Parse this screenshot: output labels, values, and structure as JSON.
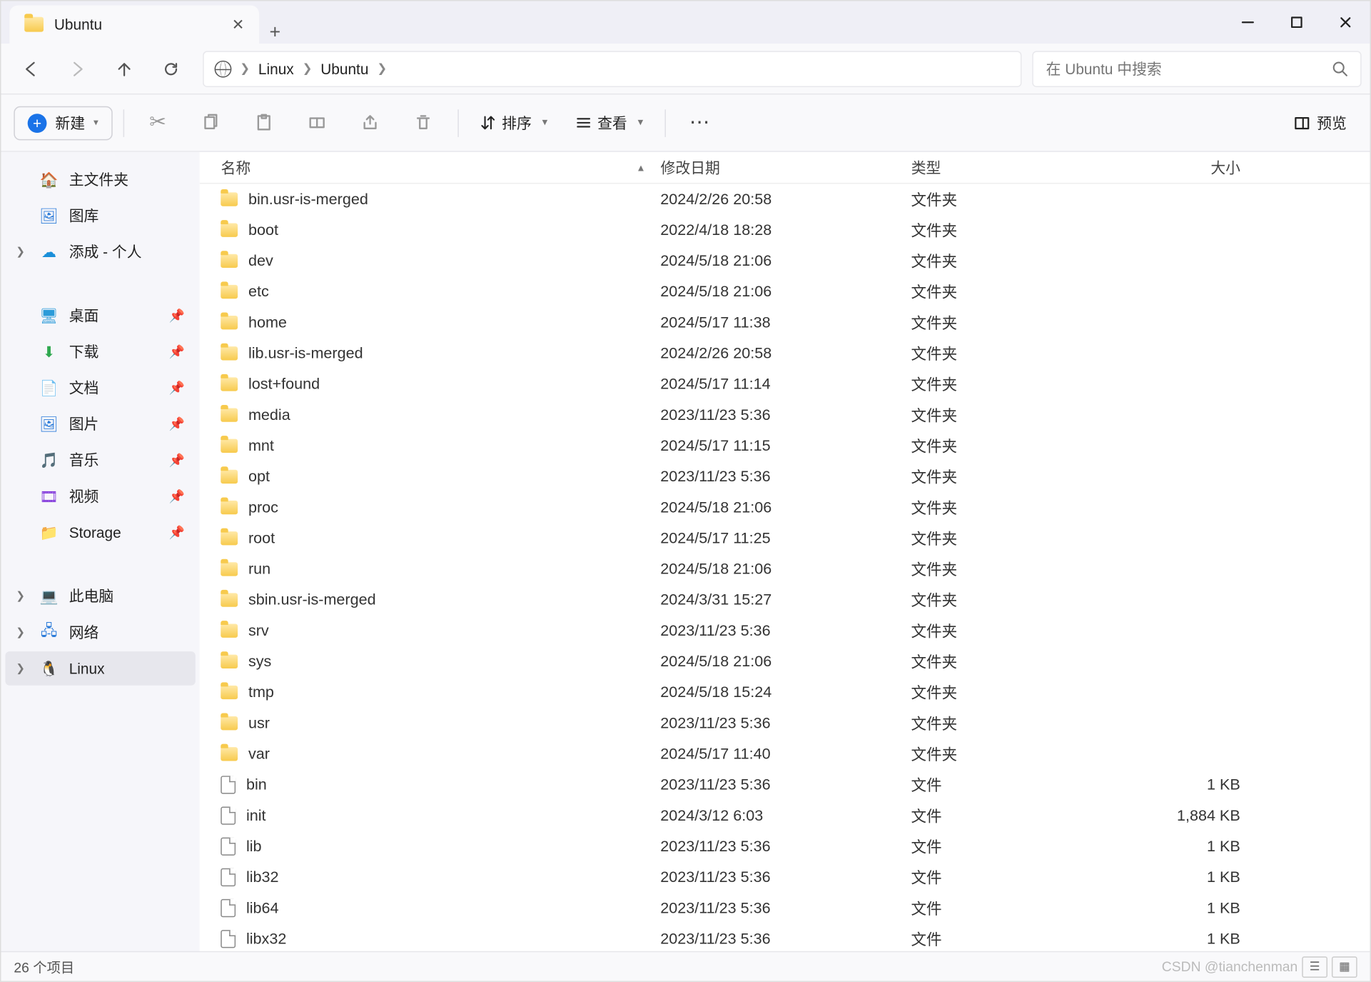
{
  "tab": {
    "title": "Ubuntu"
  },
  "breadcrumb": {
    "items": [
      "Linux",
      "Ubuntu"
    ]
  },
  "search": {
    "placeholder": "在 Ubuntu 中搜索"
  },
  "toolbar": {
    "new_label": "新建",
    "sort_label": "排序",
    "view_label": "查看",
    "preview_label": "预览"
  },
  "sidebar": {
    "home": "主文件夹",
    "gallery": "图库",
    "personal": "添成 - 个人",
    "desktop": "桌面",
    "downloads": "下载",
    "documents": "文档",
    "pictures": "图片",
    "music": "音乐",
    "videos": "视频",
    "storage": "Storage",
    "this_pc": "此电脑",
    "network": "网络",
    "linux": "Linux"
  },
  "columns": {
    "name": "名称",
    "date": "修改日期",
    "type": "类型",
    "size": "大小"
  },
  "type_labels": {
    "folder": "文件夹",
    "file": "文件"
  },
  "rows": [
    {
      "name": "bin.usr-is-merged",
      "date": "2024/2/26 20:58",
      "type": "folder",
      "size": ""
    },
    {
      "name": "boot",
      "date": "2022/4/18 18:28",
      "type": "folder",
      "size": ""
    },
    {
      "name": "dev",
      "date": "2024/5/18 21:06",
      "type": "folder",
      "size": ""
    },
    {
      "name": "etc",
      "date": "2024/5/18 21:06",
      "type": "folder",
      "size": ""
    },
    {
      "name": "home",
      "date": "2024/5/17 11:38",
      "type": "folder",
      "size": ""
    },
    {
      "name": "lib.usr-is-merged",
      "date": "2024/2/26 20:58",
      "type": "folder",
      "size": ""
    },
    {
      "name": "lost+found",
      "date": "2024/5/17 11:14",
      "type": "folder",
      "size": ""
    },
    {
      "name": "media",
      "date": "2023/11/23 5:36",
      "type": "folder",
      "size": ""
    },
    {
      "name": "mnt",
      "date": "2024/5/17 11:15",
      "type": "folder",
      "size": ""
    },
    {
      "name": "opt",
      "date": "2023/11/23 5:36",
      "type": "folder",
      "size": ""
    },
    {
      "name": "proc",
      "date": "2024/5/18 21:06",
      "type": "folder",
      "size": ""
    },
    {
      "name": "root",
      "date": "2024/5/17 11:25",
      "type": "folder",
      "size": ""
    },
    {
      "name": "run",
      "date": "2024/5/18 21:06",
      "type": "folder",
      "size": ""
    },
    {
      "name": "sbin.usr-is-merged",
      "date": "2024/3/31 15:27",
      "type": "folder",
      "size": ""
    },
    {
      "name": "srv",
      "date": "2023/11/23 5:36",
      "type": "folder",
      "size": ""
    },
    {
      "name": "sys",
      "date": "2024/5/18 21:06",
      "type": "folder",
      "size": ""
    },
    {
      "name": "tmp",
      "date": "2024/5/18 15:24",
      "type": "folder",
      "size": ""
    },
    {
      "name": "usr",
      "date": "2023/11/23 5:36",
      "type": "folder",
      "size": ""
    },
    {
      "name": "var",
      "date": "2024/5/17 11:40",
      "type": "folder",
      "size": ""
    },
    {
      "name": "bin",
      "date": "2023/11/23 5:36",
      "type": "file",
      "size": "1 KB"
    },
    {
      "name": "init",
      "date": "2024/3/12 6:03",
      "type": "file",
      "size": "1,884 KB"
    },
    {
      "name": "lib",
      "date": "2023/11/23 5:36",
      "type": "file",
      "size": "1 KB"
    },
    {
      "name": "lib32",
      "date": "2023/11/23 5:36",
      "type": "file",
      "size": "1 KB"
    },
    {
      "name": "lib64",
      "date": "2023/11/23 5:36",
      "type": "file",
      "size": "1 KB"
    },
    {
      "name": "libx32",
      "date": "2023/11/23 5:36",
      "type": "file",
      "size": "1 KB"
    }
  ],
  "status": {
    "items": "26 个项目",
    "watermark": "CSDN @tianchenman"
  }
}
